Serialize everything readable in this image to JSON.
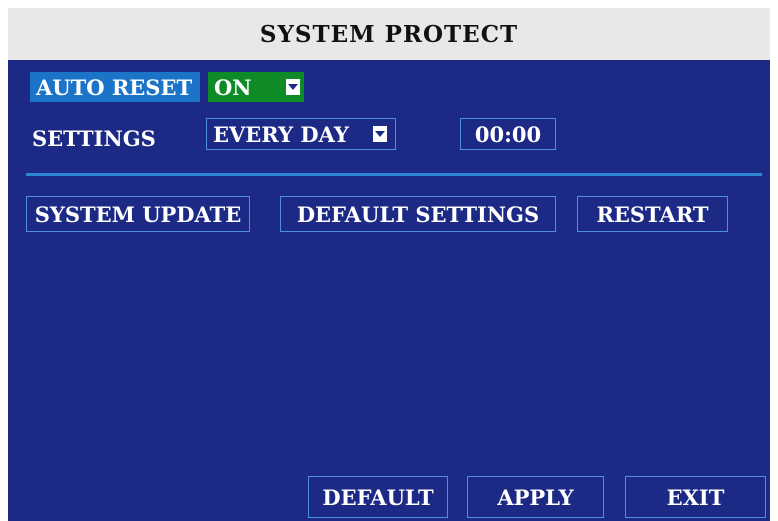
{
  "title": "SYSTEM PROTECT",
  "auto_reset": {
    "label": "AUTO RESET",
    "value": "ON"
  },
  "settings": {
    "label": "SETTINGS",
    "frequency": "EVERY DAY",
    "time": "00:00"
  },
  "actions": {
    "system_update": "SYSTEM UPDATE",
    "default_settings": "DEFAULT SETTINGS",
    "restart": "RESTART"
  },
  "footer": {
    "default": "DEFAULT",
    "apply": "APPLY",
    "exit": "EXIT"
  },
  "colors": {
    "panel_bg": "#1c2a86",
    "title_bg": "#e9e8e6",
    "highlight_blue": "#1b74c7",
    "select_green": "#0e8a27",
    "border_blue": "#4f8fda"
  },
  "icons": {
    "dropdown": "chevron-down-icon"
  }
}
